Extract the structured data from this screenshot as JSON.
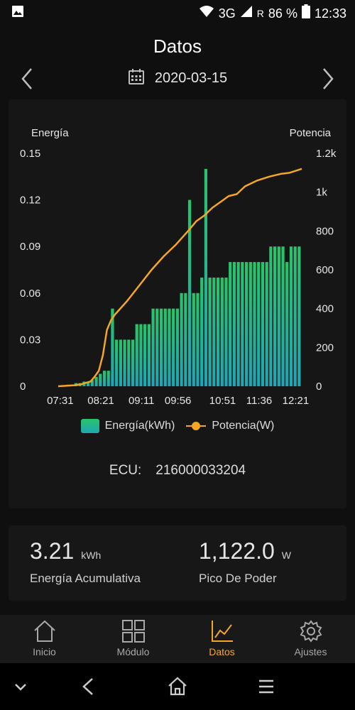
{
  "status_bar": {
    "network": "3G",
    "roaming": "R",
    "battery": "86 %",
    "time": "12:33"
  },
  "header": {
    "title": "Datos",
    "date": "2020-03-15"
  },
  "chart_data": {
    "type": "bar+line",
    "left_axis_title": "Energía",
    "right_axis_title": "Potencia",
    "left_ticks": [
      "0.15",
      "0.12",
      "0.09",
      "0.06",
      "0.03",
      "0"
    ],
    "right_ticks": [
      "1.2k",
      "1k",
      "800",
      "600",
      "400",
      "200",
      "0"
    ],
    "x_ticks": [
      "07:31",
      "08:21",
      "09:11",
      "09:56",
      "10:51",
      "11:36",
      "12:21"
    ],
    "left_range": [
      0,
      0.15
    ],
    "right_range": [
      0,
      1200
    ],
    "time_range": [
      "07:31",
      "12:31"
    ],
    "grid": false,
    "legend_position": "bottom",
    "energy_series": {
      "name": "Energía(kWh)",
      "times": [
        "07:31",
        "07:36",
        "07:41",
        "07:46",
        "07:51",
        "07:56",
        "08:01",
        "08:06",
        "08:11",
        "08:16",
        "08:21",
        "08:26",
        "08:31",
        "08:36",
        "08:41",
        "08:46",
        "08:51",
        "08:56",
        "09:01",
        "09:06",
        "09:11",
        "09:16",
        "09:21",
        "09:26",
        "09:31",
        "09:36",
        "09:41",
        "09:46",
        "09:51",
        "09:56",
        "10:01",
        "10:06",
        "10:11",
        "10:16",
        "10:21",
        "10:26",
        "10:31",
        "10:36",
        "10:41",
        "10:46",
        "10:51",
        "10:56",
        "11:01",
        "11:06",
        "11:11",
        "11:16",
        "11:21",
        "11:26",
        "11:31",
        "11:36",
        "11:41",
        "11:46",
        "11:51",
        "11:56",
        "12:01",
        "12:06",
        "12:11",
        "12:16",
        "12:21",
        "12:26"
      ],
      "values": [
        0,
        0,
        0.001,
        0.001,
        0.002,
        0.002,
        0.003,
        0.003,
        0.004,
        0.006,
        0.008,
        0.01,
        0.01,
        0.05,
        0.03,
        0.03,
        0.03,
        0.03,
        0.03,
        0.04,
        0.04,
        0.04,
        0.04,
        0.05,
        0.05,
        0.05,
        0.05,
        0.05,
        0.05,
        0.05,
        0.06,
        0.06,
        0.12,
        0.06,
        0.06,
        0.07,
        0.14,
        0.07,
        0.07,
        0.07,
        0.07,
        0.07,
        0.08,
        0.08,
        0.08,
        0.08,
        0.08,
        0.08,
        0.08,
        0.08,
        0.08,
        0.08,
        0.09,
        0.09,
        0.09,
        0.09,
        0.08,
        0.09,
        0.09,
        0.09
      ]
    },
    "power_series": {
      "name": "Potencia(W)",
      "times": [
        "07:31",
        "07:51",
        "08:01",
        "08:11",
        "08:16",
        "08:21",
        "08:26",
        "08:31",
        "08:36",
        "08:41",
        "08:56",
        "09:11",
        "09:26",
        "09:41",
        "09:56",
        "10:11",
        "10:21",
        "10:31",
        "10:41",
        "10:51",
        "11:01",
        "11:11",
        "11:21",
        "11:36",
        "11:51",
        "12:06",
        "12:16",
        "12:31"
      ],
      "values": [
        0,
        5,
        12,
        25,
        50,
        80,
        160,
        290,
        340,
        370,
        440,
        520,
        600,
        670,
        730,
        800,
        850,
        880,
        920,
        950,
        980,
        990,
        1030,
        1060,
        1080,
        1095,
        1100,
        1120
      ]
    }
  },
  "ecu": {
    "label": "ECU:",
    "value": "216000033204"
  },
  "stats": {
    "energy": {
      "value": "3.21",
      "unit": "kWh",
      "label": "Energía Acumulativa"
    },
    "peak": {
      "value": "1,122.0",
      "unit": "W",
      "label": "Pico De Poder"
    }
  },
  "tabs": [
    {
      "label": "Inicio",
      "icon": "home-icon"
    },
    {
      "label": "Módulo",
      "icon": "grid-icon"
    },
    {
      "label": "Datos",
      "icon": "chart-icon",
      "active": true
    },
    {
      "label": "Ajustes",
      "icon": "gear-icon"
    }
  ],
  "colors": {
    "accent": "#f5a623",
    "bar_top": "#27c56a",
    "bar_bottom": "#1fa6b5",
    "background": "#0f0f0f"
  }
}
